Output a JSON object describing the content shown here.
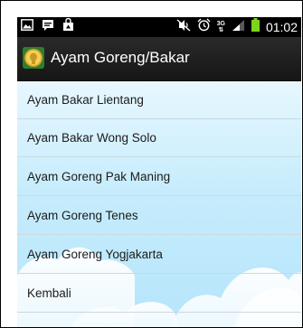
{
  "status_bar": {
    "network_label": "3G",
    "time": "01:02",
    "icons": [
      "gallery-icon",
      "chat-icon",
      "shopping-bag-icon",
      "mute-icon",
      "alarm-icon",
      "signal-icon",
      "battery-icon"
    ]
  },
  "action_bar": {
    "title": "Ayam Goreng/Bakar",
    "icon": "app-icon"
  },
  "menu": {
    "items": [
      {
        "label": "Ayam Bakar Lientang"
      },
      {
        "label": "Ayam Bakar Wong Solo"
      },
      {
        "label": "Ayam Goreng Pak Maning"
      },
      {
        "label": "Ayam Goreng Tenes"
      },
      {
        "label": "Ayam Goreng Yogjakarta"
      },
      {
        "label": "Kembali"
      }
    ]
  },
  "colors": {
    "status_bar": "#000000",
    "action_bar": "#1f1f1f",
    "sky_top": "#e7f7ff",
    "sky_bottom": "#b6e5fb",
    "battery": "#7ed321"
  }
}
